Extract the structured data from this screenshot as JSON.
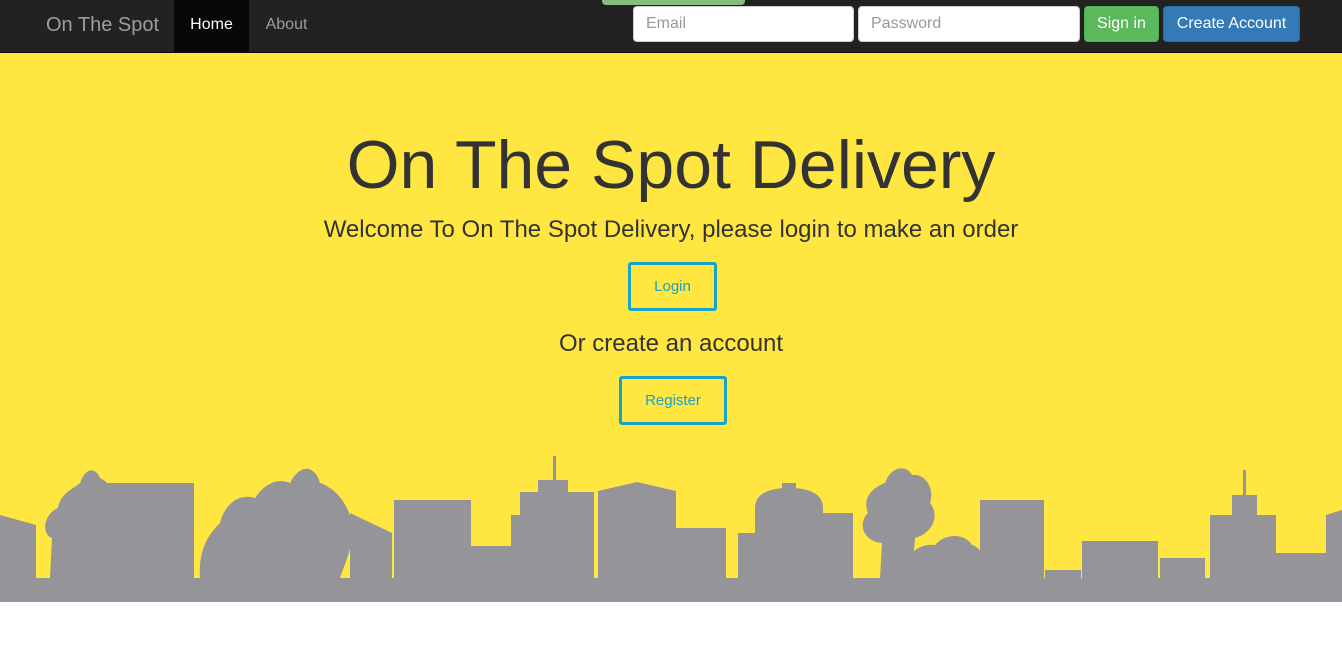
{
  "navbar": {
    "brand": "On The Spot",
    "links": [
      {
        "label": "Home",
        "active": true
      },
      {
        "label": "About",
        "active": false
      }
    ],
    "email_placeholder": "Email",
    "email_value": "",
    "password_placeholder": "Password",
    "password_value": "",
    "signin_label": "Sign in",
    "create_account_label": "Create Account"
  },
  "hero": {
    "title": "On The Spot Delivery",
    "subtitle": "Welcome To On The Spot Delivery, please login to make an order",
    "login_label": "Login",
    "or_text": "Or create an account",
    "register_label": "Register"
  },
  "colors": {
    "navbar_bg": "#222222",
    "hero_bg": "#ffe640",
    "signin_green": "#5cb85c",
    "create_blue": "#337ab7",
    "outline_accent": "#17a2c8",
    "skyline_gray": "#959599"
  }
}
